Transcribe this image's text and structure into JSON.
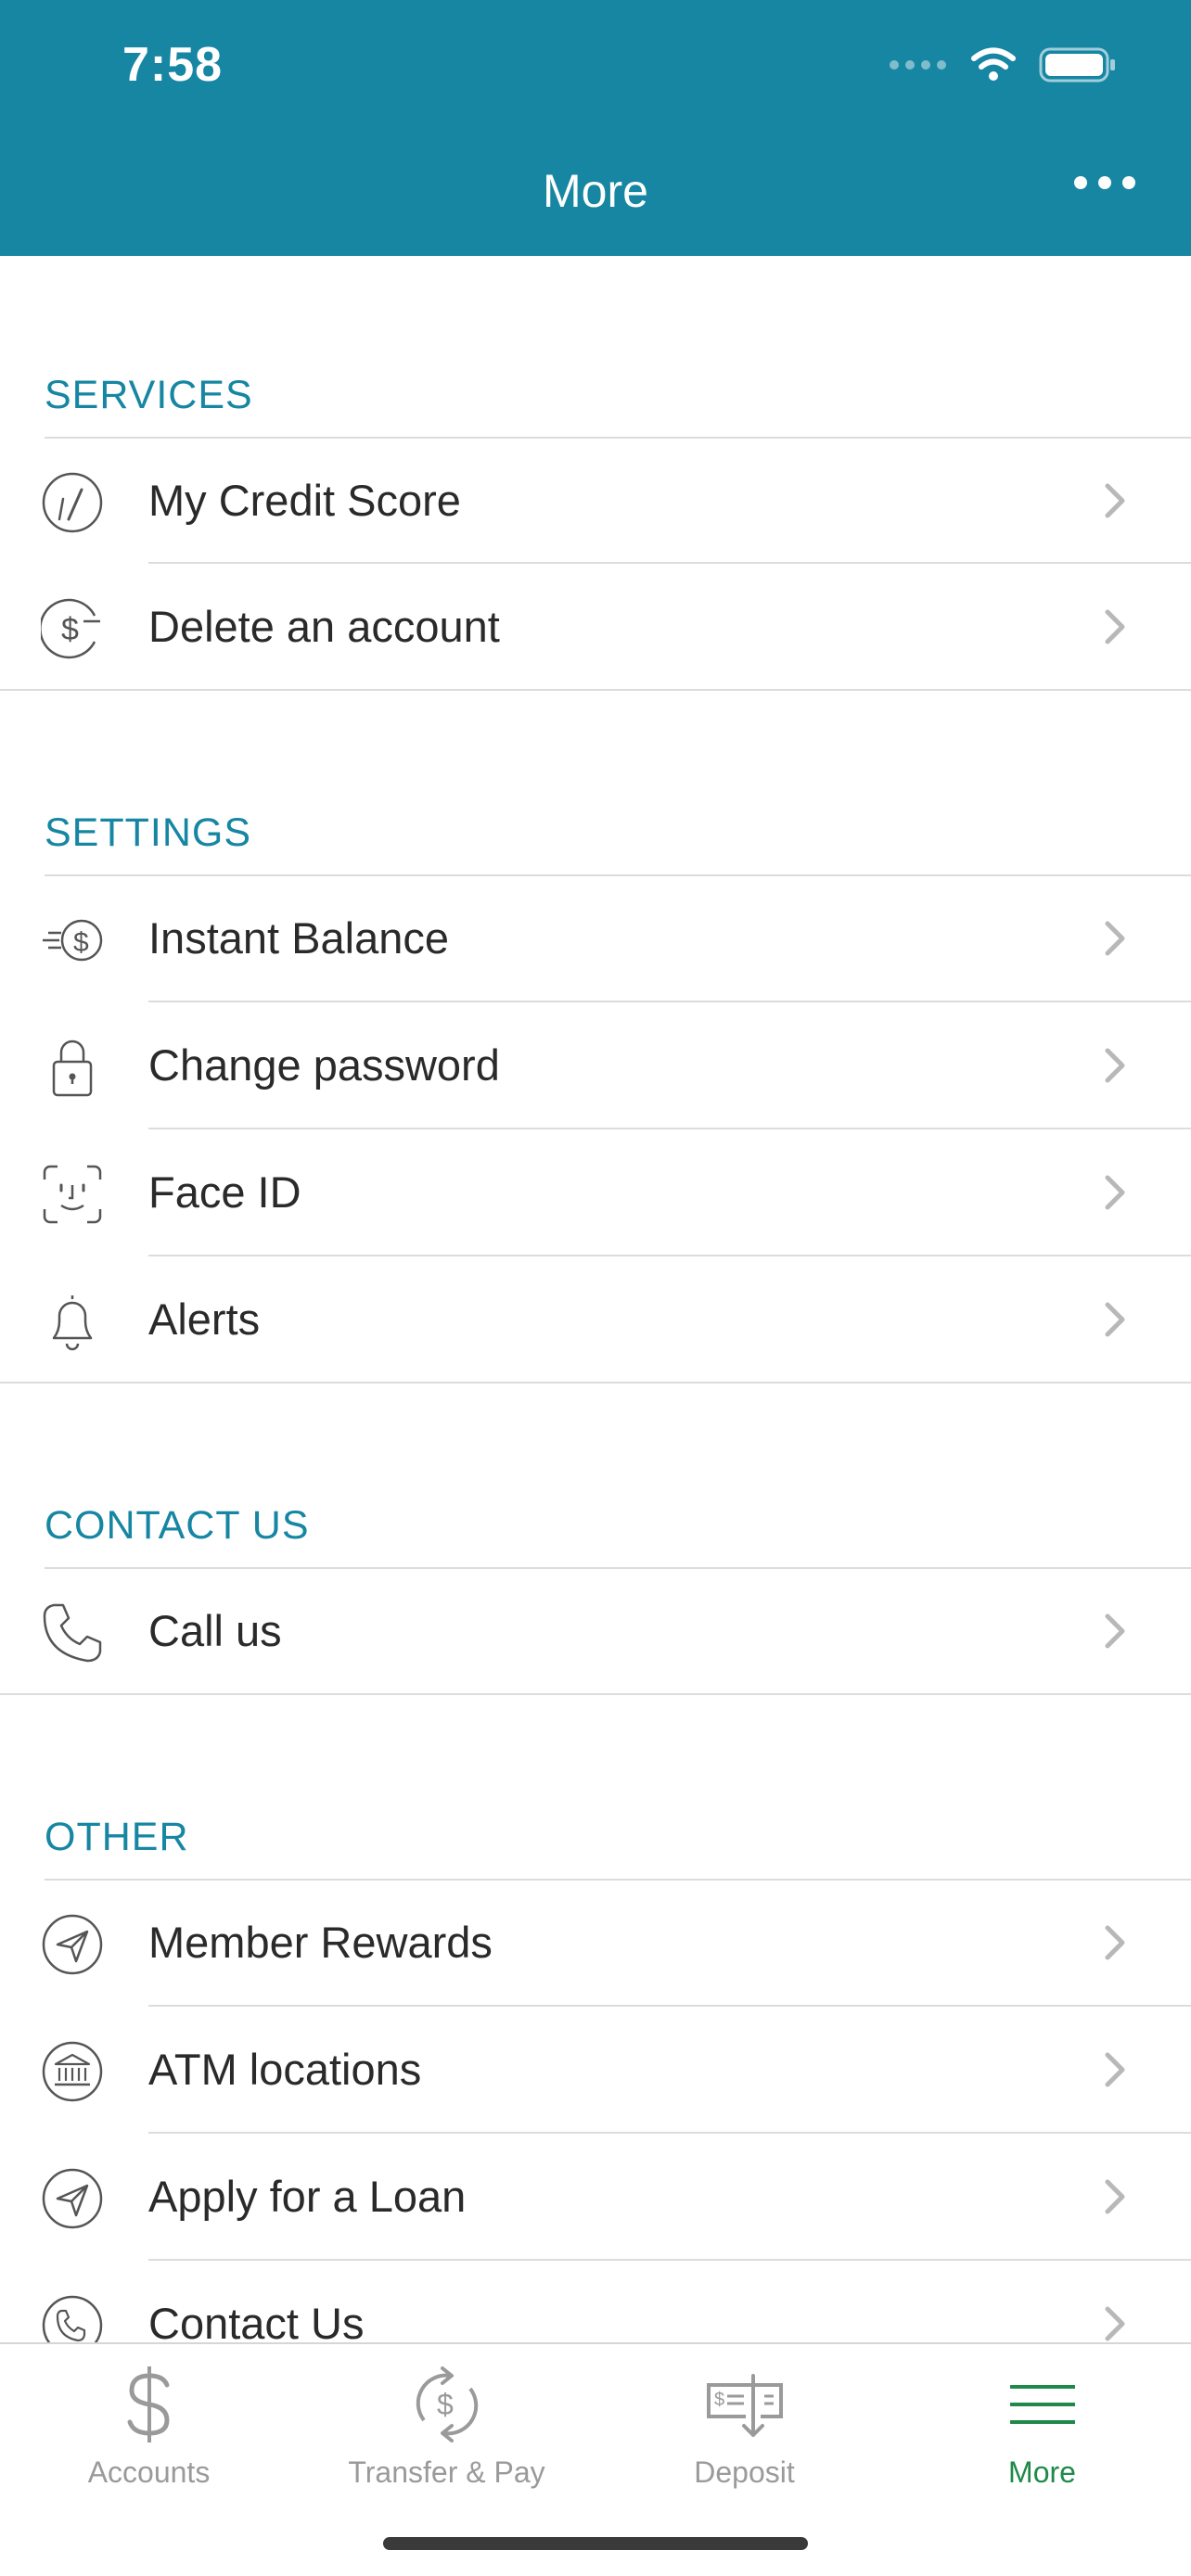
{
  "status_bar": {
    "time": "7:58"
  },
  "header": {
    "title": "More"
  },
  "sections": {
    "services": {
      "title": "SERVICES",
      "items": [
        {
          "label": "My Credit Score",
          "icon": "gauge-icon"
        },
        {
          "label": "Delete an account",
          "icon": "dollar-minus-icon"
        }
      ]
    },
    "settings": {
      "title": "SETTINGS",
      "items": [
        {
          "label": "Instant Balance",
          "icon": "fast-dollar-icon"
        },
        {
          "label": "Change password",
          "icon": "lock-icon"
        },
        {
          "label": "Face ID",
          "icon": "face-id-icon"
        },
        {
          "label": "Alerts",
          "icon": "bell-icon"
        }
      ]
    },
    "contact": {
      "title": "CONTACT US",
      "items": [
        {
          "label": "Call us",
          "icon": "phone-icon"
        }
      ]
    },
    "other": {
      "title": "OTHER",
      "items": [
        {
          "label": "Member Rewards",
          "icon": "paper-plane-icon"
        },
        {
          "label": "ATM locations",
          "icon": "bank-icon"
        },
        {
          "label": "Apply for a Loan",
          "icon": "paper-plane-icon"
        },
        {
          "label": "Contact Us",
          "icon": "phone-circle-icon"
        }
      ]
    }
  },
  "tabbar": {
    "tabs": [
      {
        "label": "Accounts",
        "icon": "dollar-icon"
      },
      {
        "label": "Transfer & Pay",
        "icon": "transfer-icon"
      },
      {
        "label": "Deposit",
        "icon": "check-deposit-icon"
      },
      {
        "label": "More",
        "icon": "menu-icon",
        "active": true
      }
    ]
  },
  "colors": {
    "header_bg": "#1686a3",
    "section_title": "#1686a3",
    "active_tab": "#1e8a4a",
    "inactive_tab": "#9a9a9a"
  }
}
